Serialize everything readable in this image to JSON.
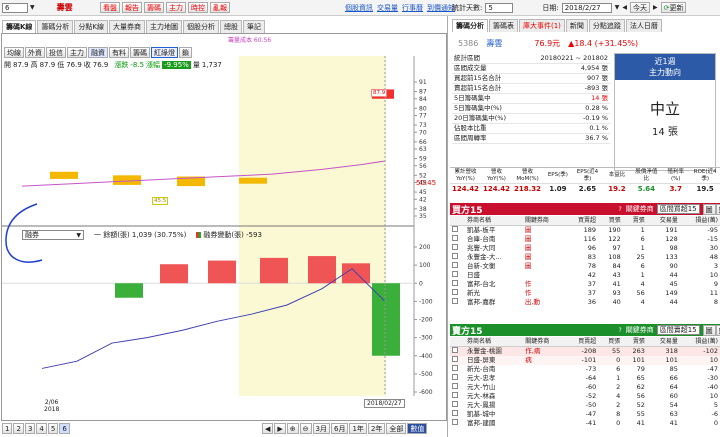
{
  "top": {
    "stock_input": "6",
    "stock_name": "壽雲",
    "tabs": [
      "看盤",
      "報告",
      "籌碼",
      "主力",
      "時控",
      "亂報"
    ],
    "links": [
      "個股資訊",
      "交易量",
      "行事曆",
      "到價通知"
    ],
    "days_label": "統計天數:",
    "days_value": "5",
    "date_label": "日期:",
    "date_value": "2018/2/27",
    "today_btn": "今天",
    "refresh_btn": "更新"
  },
  "subtabs": [
    "籌碼K線",
    "籌碼分析",
    "分點K線",
    "大量券商",
    "主力地圖",
    "個股分析",
    "總股",
    "筆記"
  ],
  "filters": [
    "均線",
    "外資",
    "投信",
    "主力",
    "融資",
    "有料",
    "籌碼",
    "紅綠燈",
    "鎖"
  ],
  "legend_top": "籌量成本 60.56",
  "ohlc": {
    "open_l": "開",
    "open": "87.9",
    "high_l": "高",
    "high": "87.9",
    "low_l": "低",
    "low": "76.9",
    "close_l": "收",
    "close": "76.9",
    "chg_l": "漲跌",
    "chg": "-8.5",
    "pct_l": "漲幅",
    "pct": "-9.95%",
    "vol_l": "量",
    "vol": "1,737"
  },
  "price_axis": [
    "91",
    "87",
    "84",
    "80",
    "77",
    "73",
    "70",
    "66",
    "63",
    "59",
    "56",
    "52",
    "49",
    "45",
    "42",
    "38",
    "35"
  ],
  "price_mark": "50.45",
  "price_tag_high": "87.9",
  "price_tag_low": "45.5",
  "lower_panel": {
    "select": "融券",
    "line_label": "一 餘額(張) 1,039 (30.75%)",
    "bar_label": "融券變動(張) -593"
  },
  "lower_axis": [
    "200",
    "100",
    "0",
    "-100",
    "-200",
    "-300",
    "-400",
    "-500",
    "-600"
  ],
  "x_labels": {
    "left": "2/06\n2018",
    "right": "2018/02/27"
  },
  "bottom_pages": [
    "1",
    "2",
    "3",
    "4",
    "5",
    "6"
  ],
  "bottom_zoom": [
    "3月",
    "6月",
    "1年",
    "2年",
    "全部",
    "數值"
  ],
  "analysis": {
    "tabs": [
      "籌碼分析",
      "籌碼表",
      "庫大事件(1)",
      "新聞",
      "分點追蹤",
      "法人日曆"
    ],
    "code": "5386",
    "name": "壽雲",
    "price": "76.9元",
    "change": "▲18.4 (+31.45%)",
    "stats": [
      {
        "label": "統計區間",
        "value": "20180221 ~ 201802"
      },
      {
        "label": "區間成交量",
        "value": "4,954 張"
      },
      {
        "label": "買超前15名合計",
        "value": "907 張"
      },
      {
        "label": "賣超前15名合計",
        "value": "-893 張"
      },
      {
        "label": "5日籌碼集中",
        "value": "14 張"
      },
      {
        "label": "5日籌碼集中(%)",
        "value": "0.28 %"
      },
      {
        "label": "20日籌碼集中(%)",
        "value": "-0.19 %"
      },
      {
        "label": "佔股本比重",
        "value": "0.1 %"
      },
      {
        "label": "區間周轉率",
        "value": "36.7 %"
      }
    ],
    "summary_label": "近1週\n主力動向",
    "summary_state": "中立",
    "summary_value": "14 張"
  },
  "fundamentals": {
    "headers": [
      "累計營收YoY(%)",
      "營收YoY(%)",
      "營收MoM(%)",
      "EPS(季)",
      "EPS(近4季)",
      "本益比",
      "股價淨值比",
      "殖利率(%)",
      "ROE(近4季)"
    ],
    "values": [
      "124.42",
      "124.42",
      "218.32",
      "1.09",
      "2.65",
      "19.2",
      "5.64",
      "3.7",
      "19.5"
    ]
  },
  "buy15": {
    "title": "買方15",
    "sel_label": "關鍵券商",
    "sel_value": "區間買超15",
    "btn1": "圖",
    "btn2": "鈕",
    "headers": [
      "",
      "券商名稱",
      "關鍵券商",
      "買賣超",
      "買張",
      "賣張",
      "交易量",
      "損益(萬)"
    ],
    "rows": [
      [
        "凱基-板平",
        "圖",
        "189",
        "190",
        "1",
        "191",
        "-95"
      ],
      [
        "合庫-台南",
        "圖",
        "116",
        "122",
        "6",
        "128",
        "-15"
      ],
      [
        "兆豐-大同",
        "圖",
        "96",
        "97",
        "1",
        "98",
        "30"
      ],
      [
        "永豐金-大...",
        "圖",
        "83",
        "108",
        "25",
        "133",
        "48"
      ],
      [
        "台新-文衡",
        "圖",
        "78",
        "84",
        "6",
        "90",
        "3"
      ],
      [
        "日盛",
        "",
        "42",
        "43",
        "1",
        "44",
        "10"
      ],
      [
        "富邦-台北",
        "作",
        "37",
        "41",
        "4",
        "45",
        "9"
      ],
      [
        "新光",
        "作",
        "37",
        "93",
        "56",
        "149",
        "11"
      ],
      [
        "富邦-嘉群",
        "出,動",
        "36",
        "40",
        "4",
        "44",
        "8"
      ]
    ]
  },
  "sell15": {
    "title": "賣方15",
    "sel_label": "關鍵券商",
    "sel_value": "區間賣超15",
    "btn1": "圖",
    "btn2": "鈕",
    "headers": [
      "",
      "券商名稱",
      "關鍵券商",
      "買賣超",
      "買張",
      "賣張",
      "交易量",
      "損益(萬)"
    ],
    "rows": [
      [
        "永豐金-桃園",
        "作,病",
        "-208",
        "55",
        "263",
        "318",
        "-102"
      ],
      [
        "日盛-屏東",
        "病",
        "-101",
        "0",
        "101",
        "101",
        "10"
      ],
      [
        "新光-台南",
        "",
        "-73",
        "6",
        "79",
        "85",
        "-47"
      ],
      [
        "元大-忠孝",
        "",
        "-64",
        "1",
        "65",
        "66",
        "-30"
      ],
      [
        "元大-竹山",
        "",
        "-60",
        "2",
        "62",
        "64",
        "-40"
      ],
      [
        "元大-林森",
        "",
        "-52",
        "4",
        "56",
        "60",
        "10"
      ],
      [
        "元大-鳳揚",
        "",
        "-50",
        "2",
        "52",
        "54",
        "5"
      ],
      [
        "凱基-城中",
        "",
        "-47",
        "8",
        "55",
        "63",
        "-6"
      ],
      [
        "富邦-建國",
        "",
        "-41",
        "0",
        "41",
        "41",
        "0"
      ]
    ]
  },
  "chart_data": [
    {
      "type": "bar",
      "title": "",
      "bars": [
        {
          "open": 84.0,
          "close": 87.9,
          "dir": "up"
        },
        {
          "open": 53.5,
          "close": 50.5,
          "dir": "flat"
        },
        {
          "open": 52.0,
          "close": 48.0,
          "dir": "flat"
        },
        {
          "open": 51.5,
          "close": 47.5,
          "dir": "flat"
        },
        {
          "open": 51.0,
          "close": 48.5,
          "dir": "flat"
        }
      ],
      "avg_line": [
        47.5,
        48.5,
        49.5,
        50.5,
        51.5,
        52.5,
        54.5,
        56.5,
        58.0
      ],
      "ylim": [
        35,
        91
      ]
    },
    {
      "type": "bar",
      "title": "",
      "series": [
        {
          "name": "融券變動(張)",
          "values": [
            140,
            130,
            -20,
            -80,
            105,
            125,
            140,
            150,
            110,
            -400
          ]
        }
      ],
      "line": {
        "name": "餘額(張)",
        "values": [
          -470,
          -430,
          -330,
          -300,
          -260,
          -210,
          -170,
          -120,
          -30,
          80,
          -100
        ]
      },
      "ylim": [
        -600,
        200
      ]
    }
  ]
}
